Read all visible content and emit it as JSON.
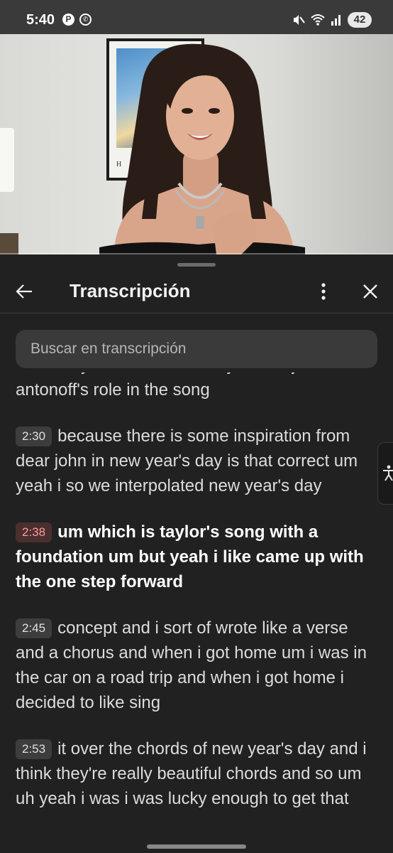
{
  "status_bar": {
    "time": "5:40",
    "notification_icons": [
      "pinterest-icon",
      "whatsapp-icon"
    ],
    "system_icons": [
      "mute-icon",
      "wifi-icon",
      "signal-icon"
    ],
    "battery": "42"
  },
  "sheet": {
    "title": "Transcripción",
    "search": {
      "placeholder": "Buscar en transcripción",
      "value": ""
    }
  },
  "transcript": {
    "segments": [
      {
        "time": "",
        "text": "had can you describe like taylor and jack antonoff's role in the song",
        "active": false,
        "partial": true
      },
      {
        "time": "2:30",
        "text": "because there is some inspiration from dear john in new year's day is that correct um yeah i so we interpolated new year's day",
        "active": false,
        "partial": false
      },
      {
        "time": "2:38",
        "text": "um which is taylor's song with a foundation um but yeah i like came up with the one step forward",
        "active": true,
        "partial": false
      },
      {
        "time": "2:45",
        "text": "concept and i sort of wrote like a verse and a chorus and when i got home um i was in the car on a road trip and when i got home i decided to like sing",
        "active": false,
        "partial": false
      },
      {
        "time": "2:53",
        "text": "it over the chords of new year's day and i think they're really beautiful chords and so um uh yeah i was i was lucky enough to get that",
        "active": false,
        "partial": false
      }
    ]
  },
  "colors": {
    "sheet_background": "#212121",
    "search_background": "#3a3a3a",
    "active_timestamp_text": "#ff9b9b",
    "active_timestamp_background": "#4a2f2f",
    "timestamp_background": "#3d3d3d"
  },
  "icons": {
    "back": "arrow-left-icon",
    "more": "more-vertical-icon",
    "close": "close-icon",
    "accessibility": "accessibility-icon"
  }
}
